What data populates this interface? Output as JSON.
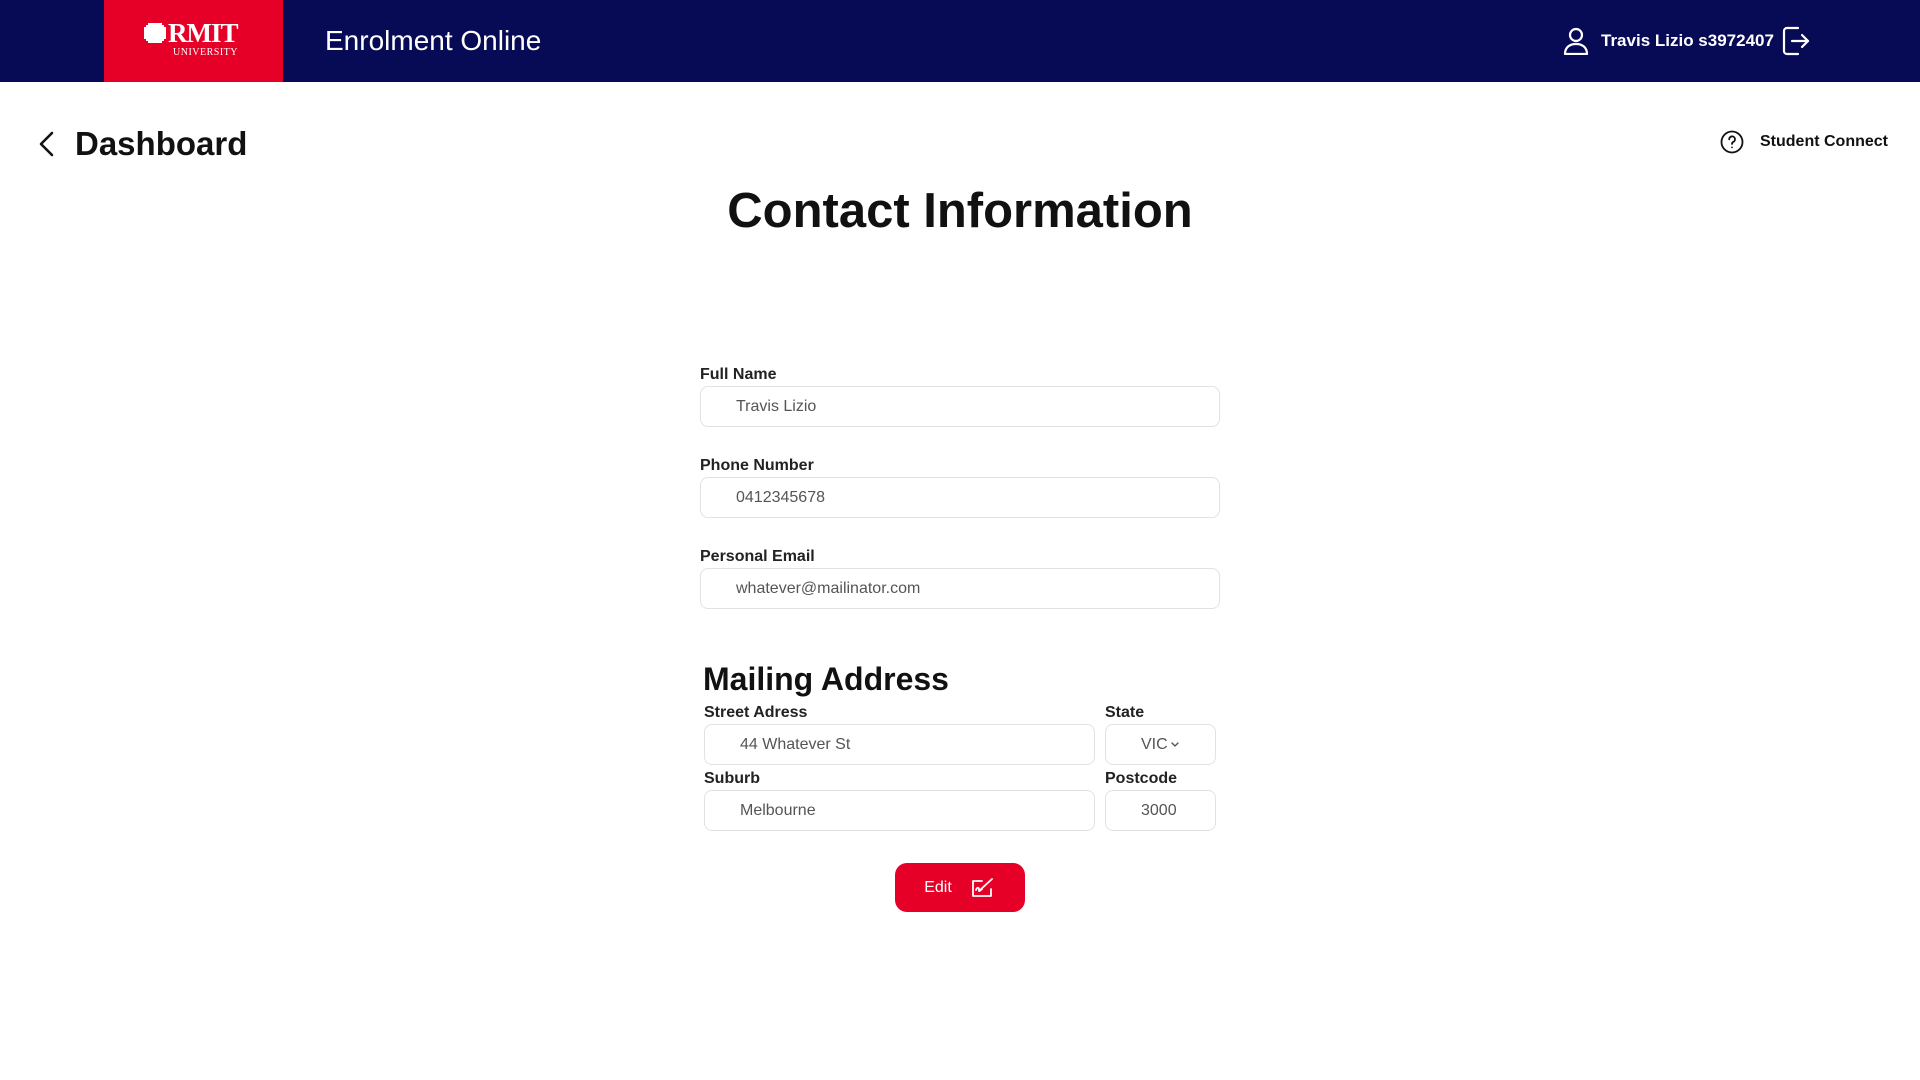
{
  "header": {
    "logo_text": "RMIT",
    "logo_subtext": "UNIVERSITY",
    "app_title": "Enrolment Online",
    "user_label": "Travis Lizio s3972407",
    "user_icon": "user-icon",
    "logout_icon": "logout-icon"
  },
  "nav": {
    "back_label": "Dashboard",
    "back_icon": "chevron-left-icon",
    "help_label": "Student Connect",
    "help_icon": "question-circle-icon"
  },
  "page": {
    "title": "Contact Information"
  },
  "form": {
    "full_name": {
      "label": "Full Name",
      "value": "Travis Lizio"
    },
    "phone": {
      "label": "Phone Number",
      "value": "0412345678"
    },
    "email": {
      "label": "Personal Email",
      "value": "whatever@mailinator.com"
    }
  },
  "mailing": {
    "title": "Mailing Address",
    "street": {
      "label": "Street Adress",
      "value": "44 Whatever St"
    },
    "state": {
      "label": "State",
      "value": "VIC"
    },
    "suburb": {
      "label": "Suburb",
      "value": "Melbourne"
    },
    "postcode": {
      "label": "Postcode",
      "value": "3000"
    }
  },
  "actions": {
    "edit_label": "Edit",
    "edit_icon": "edit-signature-icon"
  },
  "colors": {
    "header_bg": "#070b55",
    "brand_red": "#e60028"
  }
}
